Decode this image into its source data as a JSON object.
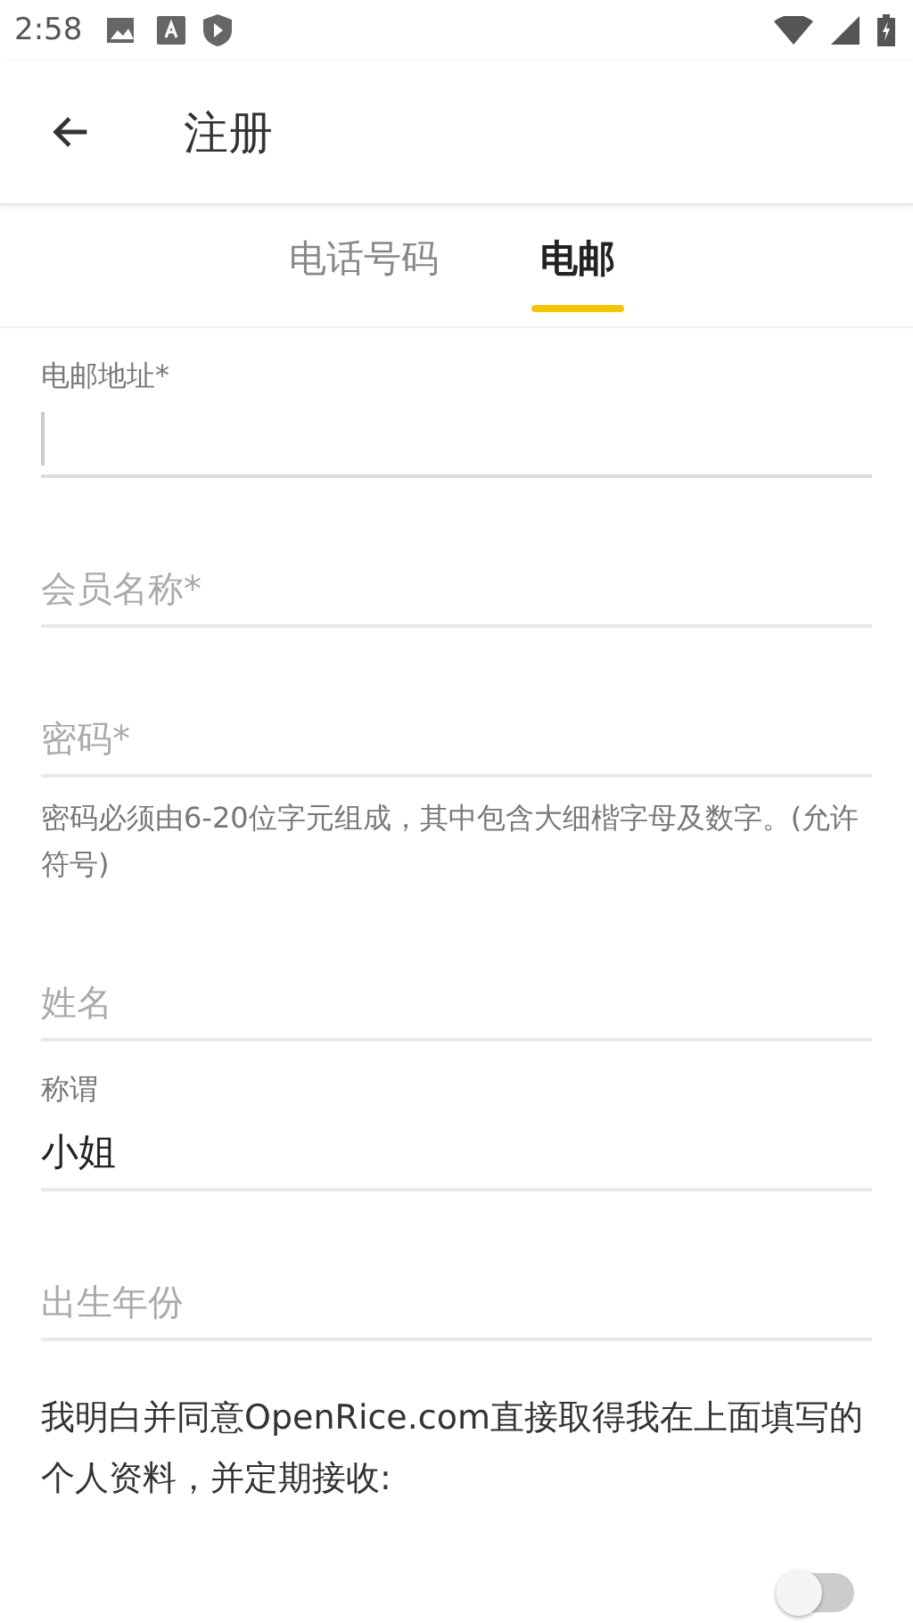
{
  "status_bar": {
    "time": "2:58"
  },
  "app_bar": {
    "title": "注册"
  },
  "tabs": [
    {
      "label": "电话号码",
      "selected": false
    },
    {
      "label": "电邮",
      "selected": true
    }
  ],
  "fields": [
    {
      "kind": "labeled",
      "label": "电邮地址*",
      "focused": true
    },
    {
      "kind": "empty",
      "placeholder": "会员名称*",
      "focused": false
    },
    {
      "kind": "empty",
      "placeholder": "密码*",
      "focused": false,
      "helper": "密码必须由6-20位字元组成，其中包含大细楷字母及数字。(允许符号)"
    },
    {
      "kind": "empty",
      "placeholder": "姓名",
      "focused": false
    },
    {
      "kind": "labeled",
      "label": "称谓",
      "value": "小姐",
      "focused": false
    },
    {
      "kind": "empty",
      "placeholder": "出生年份",
      "focused": false
    }
  ],
  "consent": "我明白并同意OpenRice.com直接取得我在上面填写的个人资料，并定期接收:",
  "subscription_toggle": {
    "on": false
  }
}
